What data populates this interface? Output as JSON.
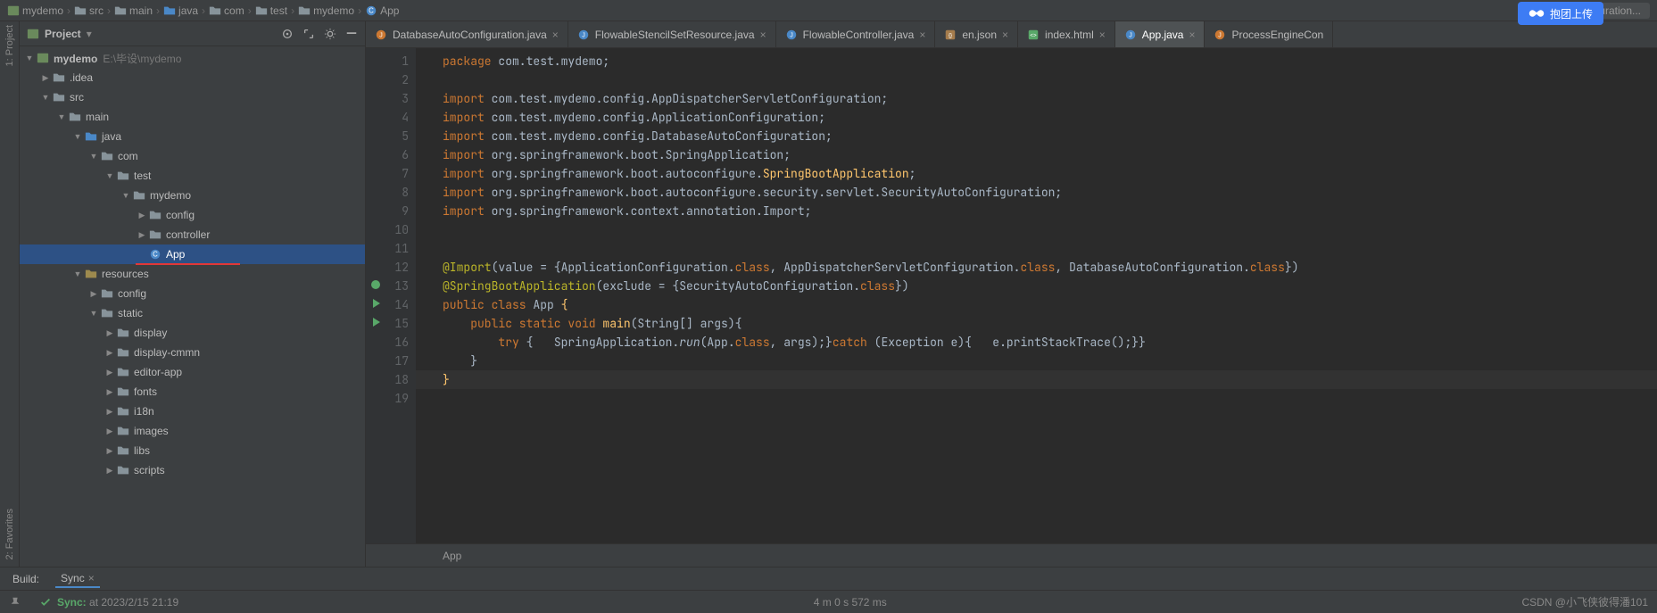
{
  "breadcrumb": {
    "parts": [
      "mydemo",
      "src",
      "main",
      "java",
      "com",
      "test",
      "mydemo",
      "App"
    ],
    "run_config": "Add Configuration..."
  },
  "overlay": {
    "label": "抱团上传"
  },
  "side_tabs": {
    "project": "1: Project",
    "favorites": "2: Favorites"
  },
  "project": {
    "title": "Project",
    "root": {
      "name": "mydemo",
      "path": "E:\\毕设\\mydemo"
    },
    "nodes": [
      {
        "indent": 1,
        "arrow": "closed",
        "icon": "folder",
        "label": ".idea"
      },
      {
        "indent": 1,
        "arrow": "open",
        "icon": "folder",
        "label": "src"
      },
      {
        "indent": 2,
        "arrow": "open",
        "icon": "folder",
        "label": "main"
      },
      {
        "indent": 3,
        "arrow": "open",
        "icon": "folder-src",
        "label": "java"
      },
      {
        "indent": 4,
        "arrow": "open",
        "icon": "folder",
        "label": "com"
      },
      {
        "indent": 5,
        "arrow": "open",
        "icon": "folder",
        "label": "test"
      },
      {
        "indent": 6,
        "arrow": "open",
        "icon": "folder",
        "label": "mydemo"
      },
      {
        "indent": 7,
        "arrow": "closed",
        "icon": "folder",
        "label": "config"
      },
      {
        "indent": 7,
        "arrow": "closed",
        "icon": "folder",
        "label": "controller"
      },
      {
        "indent": 7,
        "arrow": "none",
        "icon": "class",
        "label": "App",
        "selected": true,
        "underline": true
      },
      {
        "indent": 3,
        "arrow": "open",
        "icon": "folder-res",
        "label": "resources"
      },
      {
        "indent": 4,
        "arrow": "closed",
        "icon": "folder",
        "label": "config"
      },
      {
        "indent": 4,
        "arrow": "open",
        "icon": "folder",
        "label": "static"
      },
      {
        "indent": 5,
        "arrow": "closed",
        "icon": "folder",
        "label": "display"
      },
      {
        "indent": 5,
        "arrow": "closed",
        "icon": "folder",
        "label": "display-cmmn"
      },
      {
        "indent": 5,
        "arrow": "closed",
        "icon": "folder",
        "label": "editor-app"
      },
      {
        "indent": 5,
        "arrow": "closed",
        "icon": "folder",
        "label": "fonts"
      },
      {
        "indent": 5,
        "arrow": "closed",
        "icon": "folder",
        "label": "i18n"
      },
      {
        "indent": 5,
        "arrow": "closed",
        "icon": "folder",
        "label": "images"
      },
      {
        "indent": 5,
        "arrow": "closed",
        "icon": "folder",
        "label": "libs"
      },
      {
        "indent": 5,
        "arrow": "closed",
        "icon": "folder",
        "label": "scripts"
      }
    ]
  },
  "tabs": [
    {
      "icon": "java",
      "label": "DatabaseAutoConfiguration.java",
      "color": "#cc7832"
    },
    {
      "icon": "java",
      "label": "FlowableStencilSetResource.java",
      "color": "#4a88c7"
    },
    {
      "icon": "java",
      "label": "FlowableController.java",
      "color": "#4a88c7"
    },
    {
      "icon": "json",
      "label": "en.json",
      "color": "#bbb"
    },
    {
      "icon": "html",
      "label": "index.html",
      "color": "#bbb"
    },
    {
      "icon": "java",
      "label": "App.java",
      "color": "#4a88c7",
      "active": true
    },
    {
      "icon": "java",
      "label": "ProcessEngineCon",
      "color": "#cc7832",
      "noclose": true
    }
  ],
  "editor": {
    "crumb": "App",
    "lines": [
      {
        "n": 1,
        "html": "<span class='kw'>package</span> com.test.mydemo;"
      },
      {
        "n": 2,
        "html": ""
      },
      {
        "n": 3,
        "html": "<span class='kw'>import</span> com.test.mydemo.config.AppDispatcherServletConfiguration;",
        "fold": "-"
      },
      {
        "n": 4,
        "html": "<span class='kw'>import</span> com.test.mydemo.config.ApplicationConfiguration;"
      },
      {
        "n": 5,
        "html": "<span class='kw'>import</span> com.test.mydemo.config.DatabaseAutoConfiguration;"
      },
      {
        "n": 6,
        "html": "<span class='kw'>import</span> org.springframework.boot.SpringApplication;"
      },
      {
        "n": 7,
        "html": "<span class='kw'>import</span> org.springframework.boot.autoconfigure.<span class='ident'>SpringBootApplication</span>;"
      },
      {
        "n": 8,
        "html": "<span class='kw'>import</span> org.springframework.boot.autoconfigure.security.servlet.SecurityAutoConfiguration;"
      },
      {
        "n": 9,
        "html": "<span class='kw'>import</span> org.springframework.context.annotation.Import;",
        "fold": "_"
      },
      {
        "n": 10,
        "html": ""
      },
      {
        "n": 11,
        "html": ""
      },
      {
        "n": 12,
        "html": "<span class='ann'>@Import</span>(value = {ApplicationConfiguration.<span class='kw'>class</span>, AppDispatcherServletConfiguration.<span class='kw'>class</span>, DatabaseAutoConfiguration.<span class='kw'>class</span>})"
      },
      {
        "n": 13,
        "html": "<span class='ann'>@SpringBootApplication</span>(exclude = {SecurityAutoConfiguration.<span class='kw'>class</span>})",
        "mark": "bean"
      },
      {
        "n": 14,
        "html": "<span class='kw'>public class</span> App <span class='ident'>{</span>",
        "mark": "run",
        "fold": "-"
      },
      {
        "n": 15,
        "html": "    <span class='kw'>public static void</span> <span class='fn'>main</span>(String[] args){",
        "mark": "run"
      },
      {
        "n": 16,
        "html": "        <span class='kw'>try</span> {   SpringApplication.<span style='font-style:italic'>run</span>(App.<span class='kw'>class</span>, args);}<span class='kw'>catch</span> (Exception e){   e.printStackTrace();}}"
      },
      {
        "n": 17,
        "html": "    }"
      },
      {
        "n": 18,
        "html": "<span class='ident'>}</span>",
        "current": true
      },
      {
        "n": 19,
        "html": ""
      }
    ]
  },
  "bottom": {
    "build_label": "Build:",
    "sync_label": "Sync"
  },
  "status": {
    "sync_prefix": "Sync:",
    "sync_time": "at 2023/2/15 21:19",
    "mid": "4 m 0 s 572 ms",
    "watermark": "CSDN @小飞侠彼得潘101"
  }
}
